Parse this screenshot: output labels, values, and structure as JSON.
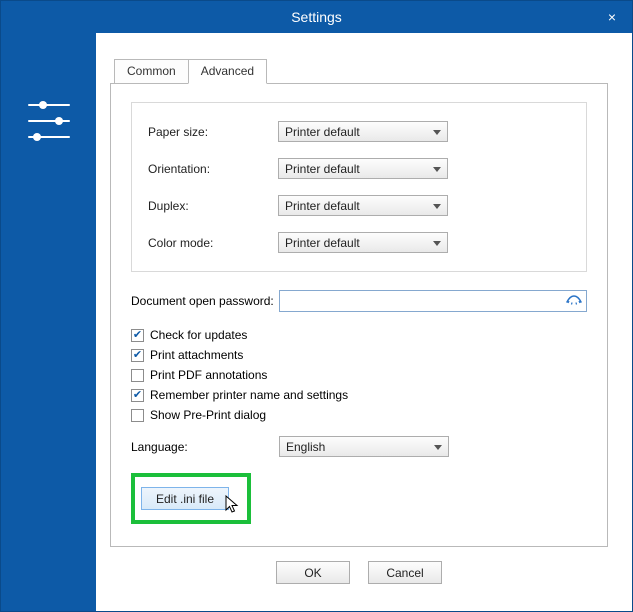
{
  "window": {
    "title": "Settings",
    "close_glyph": "×"
  },
  "tabs": {
    "common": "Common",
    "advanced": "Advanced"
  },
  "print_group": {
    "paper_size_label": "Paper size:",
    "paper_size_value": "Printer default",
    "orientation_label": "Orientation:",
    "orientation_value": "Printer default",
    "duplex_label": "Duplex:",
    "duplex_value": "Printer default",
    "color_mode_label": "Color mode:",
    "color_mode_value": "Printer default"
  },
  "password": {
    "label": "Document open password:",
    "value": ""
  },
  "checks": {
    "check_updates": {
      "label": "Check for updates",
      "checked": true
    },
    "print_attachments": {
      "label": "Print attachments",
      "checked": true
    },
    "print_annotations": {
      "label": "Print PDF annotations",
      "checked": false
    },
    "remember_printer": {
      "label": "Remember printer name and settings",
      "checked": true
    },
    "show_preprint": {
      "label": "Show Pre-Print dialog",
      "checked": false
    }
  },
  "language": {
    "label": "Language:",
    "value": "English"
  },
  "buttons": {
    "edit_ini": "Edit .ini file",
    "ok": "OK",
    "cancel": "Cancel"
  }
}
